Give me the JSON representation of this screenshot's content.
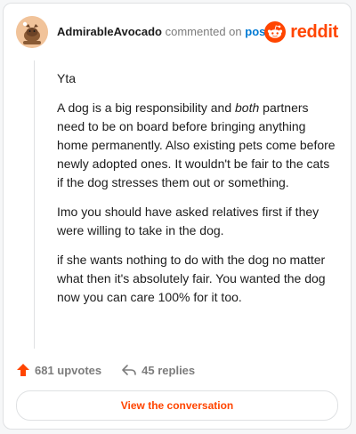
{
  "comment": {
    "username": "AdmirableAvocado",
    "action_text": "commented on",
    "post_link": "post",
    "paragraphs": [
      "Yta",
      "A dog is a big responsibility and both partners need to be on board before bringing anything home permanently. Also existing pets come before newly adopted ones. It wouldn't be fair to the cats if the dog stresses them out or something.",
      "Imo you should have asked relatives first if they were willing to take in the dog.",
      "if she wants nothing to do with the dog no matter what then it's absolutely fair. You wanted the dog now you can care 100% for it too."
    ],
    "emphasized_word": "both"
  },
  "brand": {
    "wordmark": "reddit",
    "accent_color": "#ff4500",
    "icon": "reddit-snoo-icon"
  },
  "stats": {
    "upvotes": "681 upvotes",
    "replies": "45 replies",
    "upvote_icon": "upvote-arrow-icon",
    "reply_icon": "reply-arrow-icon"
  },
  "cta": {
    "label": "View the conversation"
  },
  "colors": {
    "username": "#1c1c1c",
    "muted": "#7c7c7c",
    "link": "#0079d3",
    "border": "#dfe1e3"
  }
}
